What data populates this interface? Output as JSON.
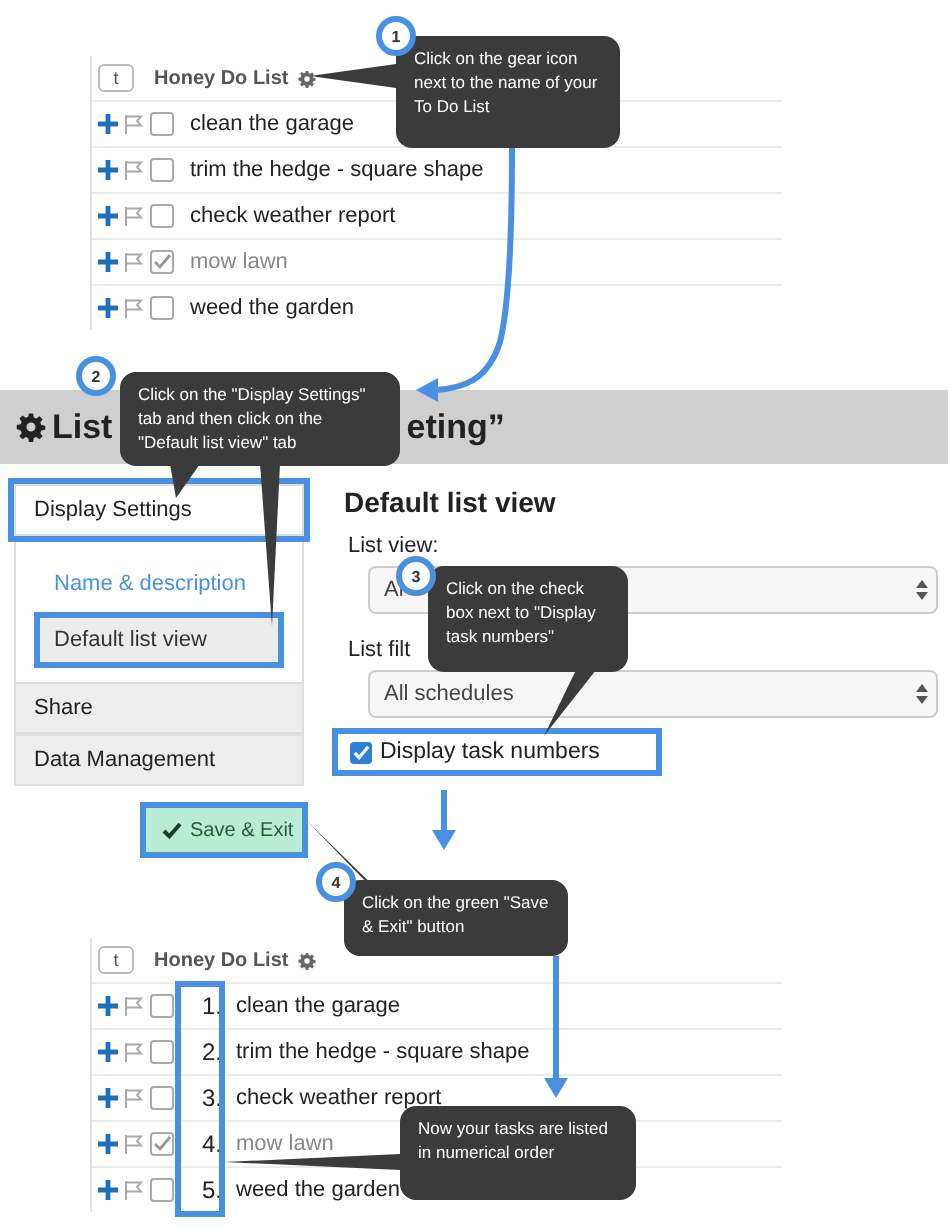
{
  "top_list": {
    "sort_button": "t",
    "title": "Honey Do List",
    "tasks": [
      {
        "text": "clean the garage",
        "checked": false
      },
      {
        "text": "trim the hedge - square shape",
        "checked": false
      },
      {
        "text": "check weather report",
        "checked": false
      },
      {
        "text": "mow lawn",
        "checked": true
      },
      {
        "text": "weed the garden",
        "checked": false
      }
    ]
  },
  "settings": {
    "heading_start": "List",
    "heading_end": "eting”",
    "sidebar": {
      "items": [
        {
          "label": "Display Settings",
          "selected": true,
          "highlighted": true,
          "children": [
            {
              "label": "Name & description",
              "selected": false,
              "highlighted": false
            },
            {
              "label": "Default list view",
              "selected": true,
              "highlighted": true
            }
          ]
        },
        {
          "label": "Share",
          "selected": false,
          "highlighted": false
        },
        {
          "label": "Data Management",
          "selected": false,
          "highlighted": false
        }
      ]
    },
    "panel": {
      "title": "Default list view",
      "list_view_label": "List view:",
      "list_view_value": "Al",
      "list_filter_label": "List filt",
      "list_filter_value": "All schedules",
      "display_task_numbers": {
        "label": "Display task numbers",
        "checked": true
      }
    },
    "save_button": "Save & Exit"
  },
  "bottom_list": {
    "sort_button": "t",
    "title": "Honey Do List",
    "tasks": [
      {
        "number": "1.",
        "text": "clean the garage",
        "checked": false
      },
      {
        "number": "2.",
        "text": "trim the hedge - square shape",
        "checked": false
      },
      {
        "number": "3.",
        "text": "check weather report",
        "checked": false
      },
      {
        "number": "4.",
        "text": "mow lawn",
        "checked": true
      },
      {
        "number": "5.",
        "text": "weed the garden",
        "checked": false
      }
    ]
  },
  "callouts": [
    {
      "number": "1",
      "text": "Click on the gear icon next to the name of your To Do List"
    },
    {
      "number": "2",
      "text": "Click on the \"Display Settings\" tab and then click on the \"Default list view\" tab"
    },
    {
      "number": "3",
      "text": "Click on the check box next to \"Display task numbers\""
    },
    {
      "number": "4",
      "text": "Click on the green \"Save & Exit\" button"
    },
    {
      "text": "Now your tasks are listed in numerical order"
    }
  ]
}
